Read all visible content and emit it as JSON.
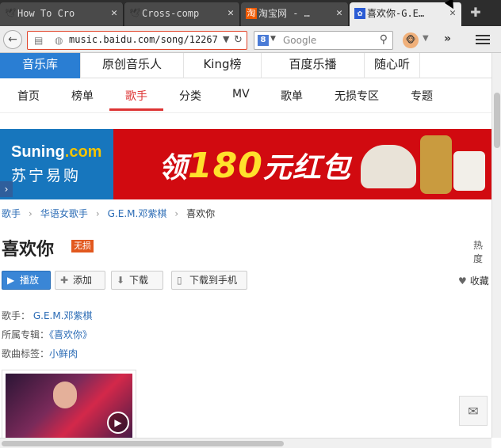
{
  "browser": {
    "tabs": [
      {
        "title": "How To Cro",
        "favicon": "bird-icon",
        "close": "✕"
      },
      {
        "title": "Cross-comp",
        "favicon": "bird-icon",
        "close": "✕"
      },
      {
        "title": "淘宝网 - …",
        "favicon": "taobao-icon",
        "favicon_char": "淘",
        "close": "✕"
      },
      {
        "title": "喜欢你-G.E…",
        "favicon": "paw-icon",
        "close": "✕"
      }
    ],
    "url": "music.baidu.com/song/12267",
    "search_placeholder": "Google"
  },
  "topnav": [
    "音乐库",
    "原创音乐人",
    "King榜",
    "百度乐播",
    "随心听"
  ],
  "subnav": [
    "首页",
    "榜单",
    "歌手",
    "分类",
    "MV",
    "歌单",
    "无损专区",
    "专题"
  ],
  "banner": {
    "brand": "Suning",
    "brand_suffix": ".com",
    "brand_cn": "苏宁易购",
    "promo_pre": "领",
    "promo_num": "180",
    "promo_post": "元红包"
  },
  "breadcrumb": [
    "歌手",
    "华语女歌手",
    "G.E.M.邓紫棋",
    "喜欢你"
  ],
  "song": {
    "title": "喜欢你",
    "badge": "无损",
    "hot_label": "热度"
  },
  "actions": {
    "play": "播放",
    "add": "添加",
    "download": "下载",
    "download_phone": "下载到手机",
    "favorite": "收藏"
  },
  "info": {
    "artist_label": "歌手：",
    "artist": "G.E.M.邓紫棋",
    "album_label": "所属专辑：",
    "album": "《喜欢你》",
    "tags_label": "歌曲标签：",
    "tag": "小鲜肉"
  },
  "colors": {
    "accent": "#2a7ed3",
    "banner_red": "#d10a10",
    "badge_orange": "#e2581e"
  }
}
